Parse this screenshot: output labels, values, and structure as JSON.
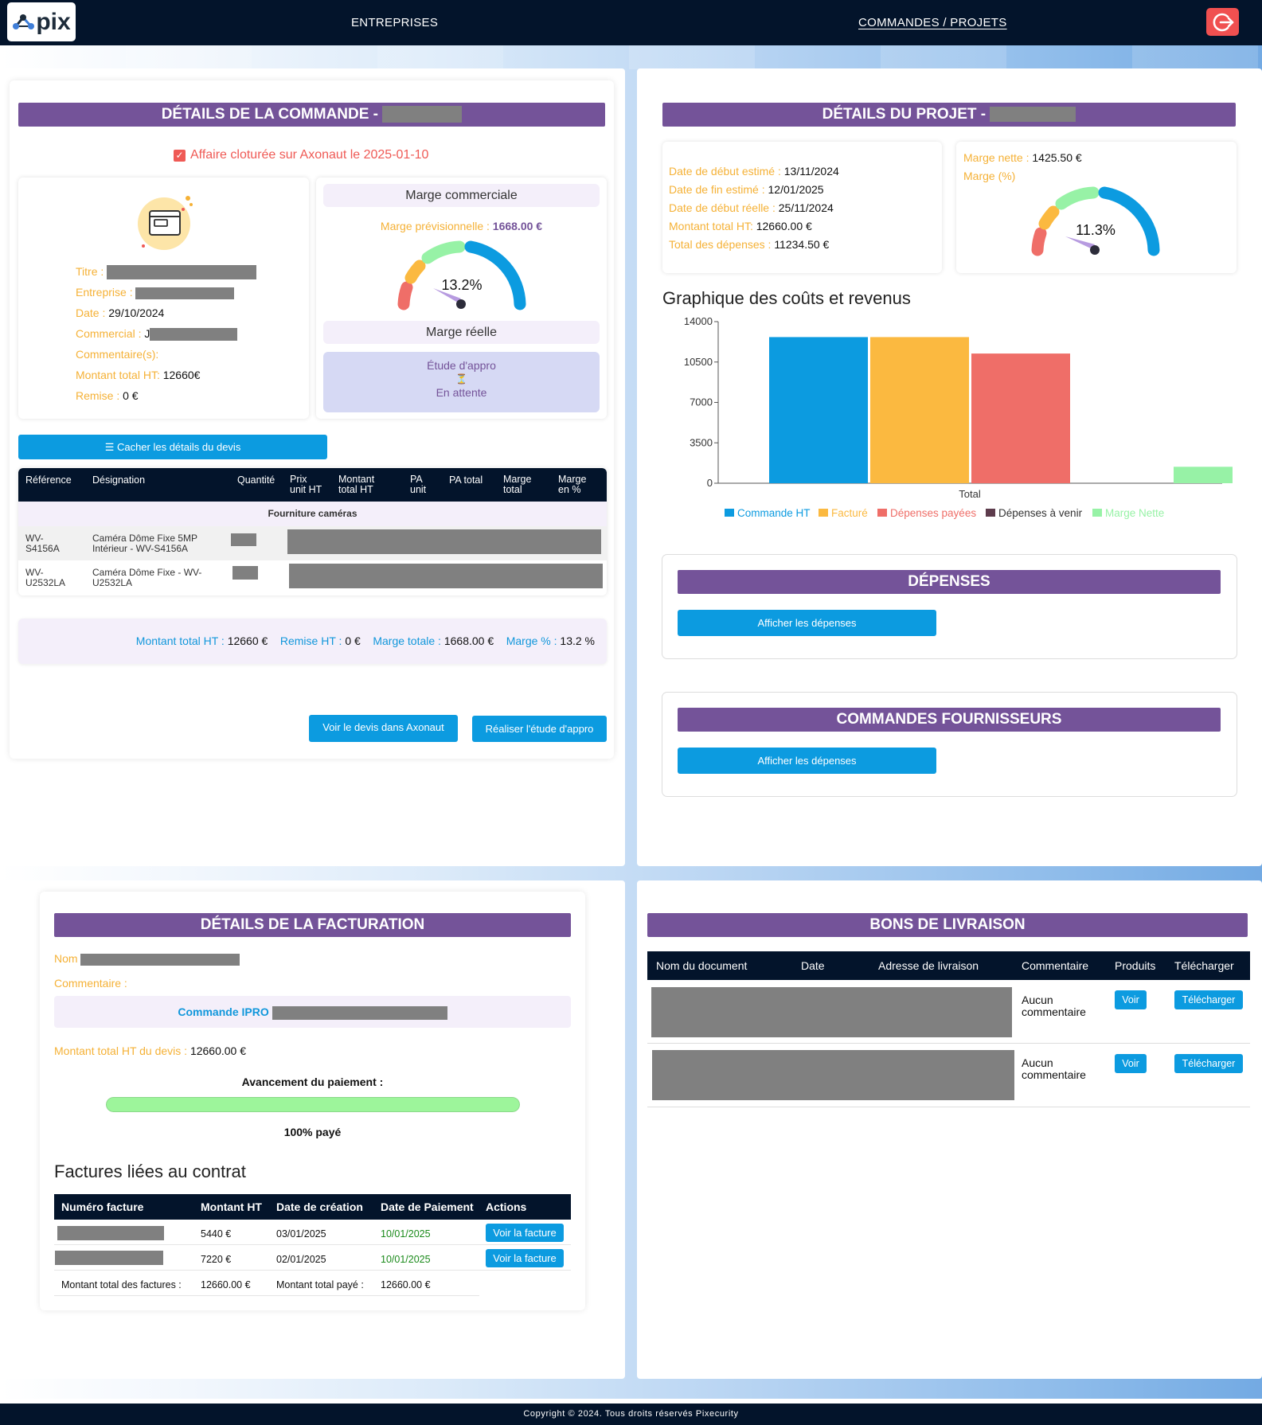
{
  "nav": {
    "logo_text": "pix",
    "item1": "ENTREPRISES",
    "item2": "COMMANDES / PROJETS",
    "logout_icon": "logout-icon"
  },
  "commande": {
    "title": "DÉTAILS DE LA COMMANDE -",
    "closed_notice": "Affaire cloturée sur Axonaut le 2025-01-10",
    "titre_label": "Titre :",
    "entreprise_label": "Entreprise :",
    "date_label": "Date :",
    "date_value": "29/10/2024",
    "commercial_label": "Commercial :",
    "commercial_partial": "J",
    "commentaire_label": "Commentaire(s):",
    "montant_label": "Montant total HT:",
    "montant_value": "12660€",
    "remise_label": "Remise :",
    "remise_value": "0 €",
    "marge_commerciale_title": "Marge commerciale",
    "marge_prev_label": "Marge prévisionnelle :",
    "marge_prev_value": "1668.00 €",
    "gauge_value_text": "13.2%",
    "gauge_value": 13.2,
    "marge_reelle_title": "Marge réelle",
    "etude_label": "Étude d'appro",
    "hourglass": "⏳",
    "etude_status": "En attente",
    "toggle_button": "☰ Cacher les détails du devis",
    "table_headers": [
      "Référence",
      "Désignation",
      "Quantité",
      "Prix unit HT",
      "Montant total HT",
      "PA unit",
      "PA total",
      "Marge total",
      "Marge en %"
    ],
    "group_label": "Fourniture caméras",
    "rows": [
      {
        "ref": "WV-S4156A",
        "designation": "Caméra Dôme Fixe 5MP Intérieur - WV-S4156A"
      },
      {
        "ref": "WV-U2532LA",
        "designation": "Caméra Dôme Fixe - WV-U2532LA"
      }
    ],
    "summary": {
      "montant_label": "Montant total HT :",
      "montant_value": "12660 €",
      "remise_label": "Remise HT :",
      "remise_value": "0 €",
      "marge_label": "Marge totale :",
      "marge_value": "1668.00 €",
      "pct_label": "Marge % :",
      "pct_value": "13.2 %"
    },
    "btn_axonaut": "Voir le devis dans Axonaut",
    "btn_appro": "Réaliser l'étude d'appro"
  },
  "projet": {
    "title": "DÉTAILS DU PROJET -",
    "debut_estime_label": "Date de début estimé :",
    "debut_estime_value": "13/11/2024",
    "fin_estime_label": "Date de fin estimé :",
    "fin_estime_value": "12/01/2025",
    "debut_reel_label": "Date de début réelle :",
    "debut_reel_value": "25/11/2024",
    "montant_label": "Montant total HT:",
    "montant_value": "12660.00 €",
    "depenses_label": "Total des dépenses :",
    "depenses_value": "11234.50 €",
    "marge_nette_label": "Marge nette :",
    "marge_nette_value": "1425.50 €",
    "marge_pct_label": "Marge (%)",
    "gauge_value_text": "11.3%",
    "gauge_value": 11.3,
    "chart_heading": "Graphique des coûts et revenus",
    "depenses_title": "DÉPENSES",
    "depenses_btn": "Afficher les dépenses",
    "fournisseurs_title": "COMMANDES FOURNISSEURS",
    "fournisseurs_btn": "Afficher les dépenses"
  },
  "chart_data": {
    "type": "bar",
    "categories": [
      "Total"
    ],
    "series": [
      {
        "name": "Commande HT",
        "values": [
          12660
        ],
        "color": "#0c9be0"
      },
      {
        "name": "Facturé",
        "values": [
          12660
        ],
        "color": "#fbb940"
      },
      {
        "name": "Dépenses payées",
        "values": [
          11234.5
        ],
        "color": "#ef6e68"
      },
      {
        "name": "Dépenses à venir",
        "values": [
          0
        ],
        "color": "#5d3c4c"
      },
      {
        "name": "Marge Nette",
        "values": [
          1425.5
        ],
        "color": "#97f2a6"
      }
    ],
    "yticks": [
      "0",
      "3500",
      "7000",
      "10500",
      "14000"
    ],
    "ylim": [
      0,
      14000
    ],
    "legend": "bottom"
  },
  "facturation": {
    "title": "DÉTAILS DE LA FACTURATION",
    "nom_label": "Nom :",
    "commentaire_label": "Commentaire :",
    "commande_label": "Commande IPRO",
    "montant_label": "Montant total HT du devis :",
    "montant_value": "12660.00 €",
    "avancement_label": "Avancement du paiement :",
    "progress": 1.0,
    "progress_text": "100% payé",
    "factures_heading": "Factures liées au contrat",
    "headers": [
      "Numéro facture",
      "Montant HT",
      "Date de création",
      "Date de Paiement",
      "Actions"
    ],
    "rows": [
      {
        "montant": "5440 €",
        "creation": "03/01/2025",
        "paiement": "10/01/2025",
        "action": "Voir la facture"
      },
      {
        "montant": "7220 €",
        "creation": "02/01/2025",
        "paiement": "10/01/2025",
        "action": "Voir la facture"
      }
    ],
    "total_label": "Montant total des factures :",
    "total_value": "12660.00 €",
    "paye_label": "Montant total payé :",
    "paye_value": "12660.00 €"
  },
  "livraison": {
    "title": "BONS DE LIVRAISON",
    "headers": [
      "Nom du document",
      "Date",
      "Adresse de livraison",
      "Commentaire",
      "Produits",
      "Télécharger"
    ],
    "rows": [
      {
        "commentaire": "Aucun commentaire",
        "voir": "Voir",
        "telecharger": "Télécharger"
      },
      {
        "commentaire": "Aucun commentaire",
        "voir": "Voir",
        "telecharger": "Télécharger"
      }
    ]
  },
  "footer": {
    "text": "Copyright © 2024. Tous droits réservés Pixecurity"
  }
}
